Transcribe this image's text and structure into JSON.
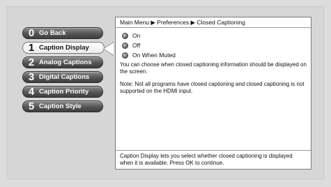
{
  "menu": {
    "items": [
      {
        "num": "0",
        "label": "Go Back"
      },
      {
        "num": "1",
        "label": "Caption Display"
      },
      {
        "num": "2",
        "label": "Analog Captions"
      },
      {
        "num": "3",
        "label": "Digital Captions"
      },
      {
        "num": "4",
        "label": "Caption Priority"
      },
      {
        "num": "5",
        "label": "Caption Style"
      }
    ],
    "selected_index": 1
  },
  "breadcrumb": "Main Menu ▶ Preferences ▶ Closed Captioning",
  "options": [
    {
      "label": "On",
      "selected": true
    },
    {
      "label": "Off",
      "selected": false
    },
    {
      "label": "On When Muted",
      "selected": false
    }
  ],
  "description": {
    "line1": "You can choose when closed captioning information should be displayed on the screen.",
    "line2": "Note: Not all programs have closed captioning and closed captioning is not supported on the HDMI input."
  },
  "footer": "Caption Display lets you select whether closed captioning is displayed when it is available. Press OK to continue."
}
